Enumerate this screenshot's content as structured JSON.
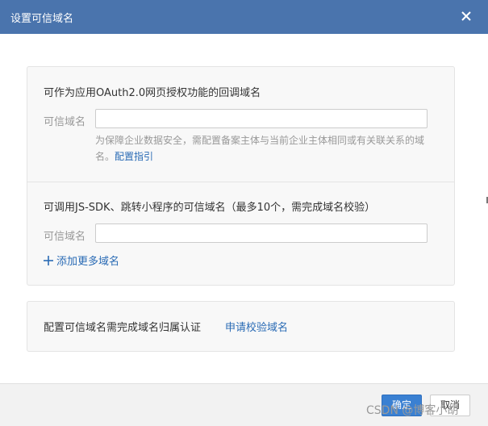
{
  "dialog": {
    "title": "设置可信域名",
    "close_icon": "close-icon"
  },
  "section1": {
    "title": "可作为应用OAuth2.0网页授权功能的回调域名",
    "field_label": "可信域名",
    "input_value": "",
    "hint_text": "为保障企业数据安全，需配置备案主体与当前企业主体相同或有关联关系的域名。",
    "hint_link": "配置指引"
  },
  "section2": {
    "title": "可调用JS-SDK、跳转小程序的可信域名（最多10个，需完成域名校验）",
    "field_label": "可信域名",
    "input_value": "",
    "add_more": "添加更多域名"
  },
  "section3": {
    "text": "配置可信域名需完成域名归属认证",
    "link": "申请校验域名"
  },
  "footer": {
    "ok": "确定",
    "cancel": "取消"
  },
  "watermark": "CSDN @博客小胡",
  "colors": {
    "titlebar": "#4a74ad",
    "link": "#2a6bb5",
    "primary_button": "#3a80d2"
  }
}
